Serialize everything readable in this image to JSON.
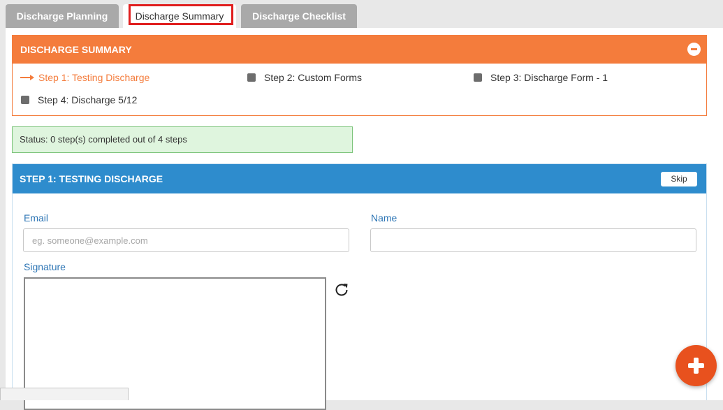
{
  "tabs": [
    {
      "label": "Discharge Planning"
    },
    {
      "label": "Discharge Summary"
    },
    {
      "label": "Discharge Checklist"
    }
  ],
  "summary": {
    "title": "DISCHARGE SUMMARY",
    "steps": [
      {
        "prefix": "Step 1:",
        "name": "Testing Discharge",
        "state": "current",
        "icon": "arrow-right-icon"
      },
      {
        "prefix": "Step 2:",
        "name": "Custom Forms",
        "state": "pending",
        "icon": "square-icon"
      },
      {
        "prefix": "Step 3:",
        "name": "Discharge Form - 1",
        "state": "pending",
        "icon": "square-icon"
      },
      {
        "prefix": "Step 4:",
        "name": "Discharge 5/12",
        "state": "pending",
        "icon": "square-icon"
      }
    ]
  },
  "status": {
    "text": "Status: 0 step(s) completed out of 4 steps"
  },
  "step_panel": {
    "title": "STEP 1: TESTING DISCHARGE",
    "skip_label": "Skip",
    "email_label": "Email",
    "email_placeholder": "eg. someone@example.com",
    "email_value": "",
    "name_label": "Name",
    "name_value": "",
    "signature_label": "Signature"
  },
  "colors": {
    "accent_orange": "#f47c3c",
    "accent_blue": "#2e8ccd",
    "status_green": "#dff5de",
    "fab_red": "#e8511e",
    "highlight_red": "#e01e1e"
  }
}
